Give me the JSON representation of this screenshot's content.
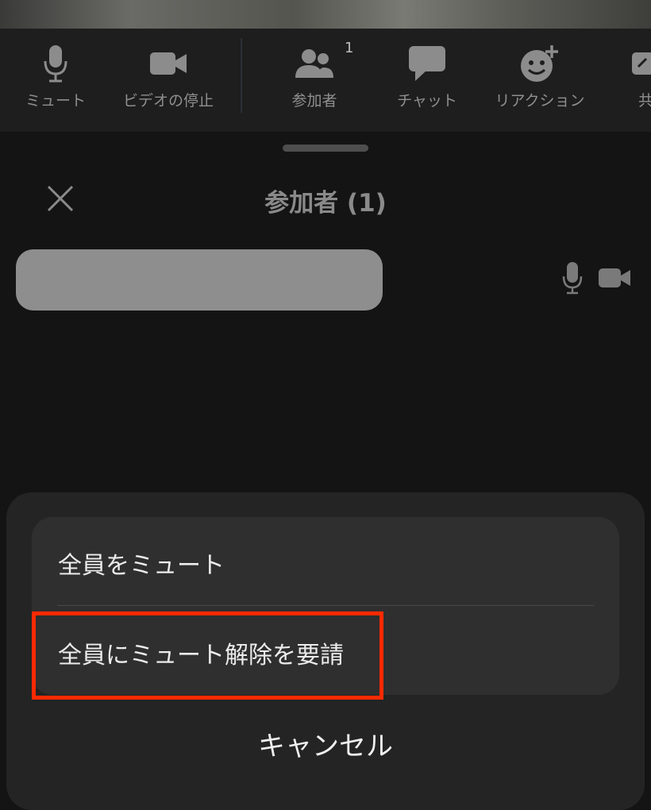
{
  "toolbar": {
    "items": [
      {
        "label": "ミュート",
        "icon": "microphone-icon"
      },
      {
        "label": "ビデオの停止",
        "icon": "video-camera-icon"
      },
      {
        "label": "参加者",
        "icon": "participants-icon",
        "badge": "1"
      },
      {
        "label": "チャット",
        "icon": "chat-bubble-icon"
      },
      {
        "label": "リアクション",
        "icon": "emoji-add-icon"
      },
      {
        "label": "共",
        "icon": "share-icon"
      }
    ]
  },
  "panel": {
    "title": "参加者 (1)",
    "close_icon": "close-icon"
  },
  "action_sheet": {
    "mute_all": "全員をミュート",
    "ask_unmute_all": "全員にミュート解除を要請",
    "cancel": "キャンセル"
  },
  "colors": {
    "background": "#141414",
    "toolbar": "#1e1e1e",
    "sheet": "#242424",
    "sheet_group": "#2f2f2f",
    "highlight": "#ff2a00"
  }
}
